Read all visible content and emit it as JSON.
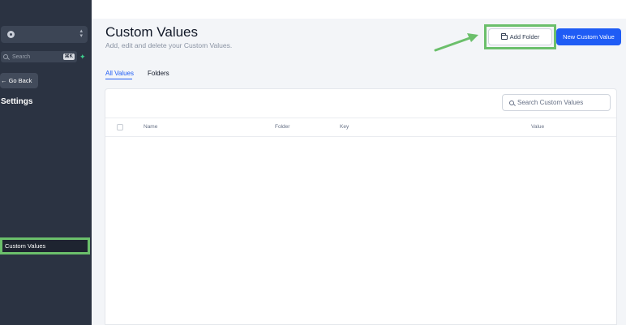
{
  "sidebar": {
    "search_placeholder": "Search",
    "search_shortcut": "⌘K",
    "go_back_label": "Go Back",
    "section_title": "Settings",
    "active_item": "Custom Values"
  },
  "header": {
    "title": "Custom Values",
    "subtitle": "Add, edit and delete your Custom Values.",
    "add_folder_label": "Add Folder",
    "new_value_label": "New Custom Value"
  },
  "tabs": [
    {
      "label": "All Values",
      "active": true
    },
    {
      "label": "Folders",
      "active": false
    }
  ],
  "table": {
    "search_placeholder": "Search Custom Values",
    "columns": [
      "Name",
      "Folder",
      "Key",
      "Value"
    ],
    "rows": []
  },
  "colors": {
    "sidebar_bg": "#2b3342",
    "accent": "#1f5cf5",
    "highlight": "#6bbf6b"
  },
  "icons": [
    "account-icon",
    "search-icon",
    "bolt-icon",
    "arrow-left-icon",
    "folder-icon",
    "chevron-updown-icon"
  ]
}
